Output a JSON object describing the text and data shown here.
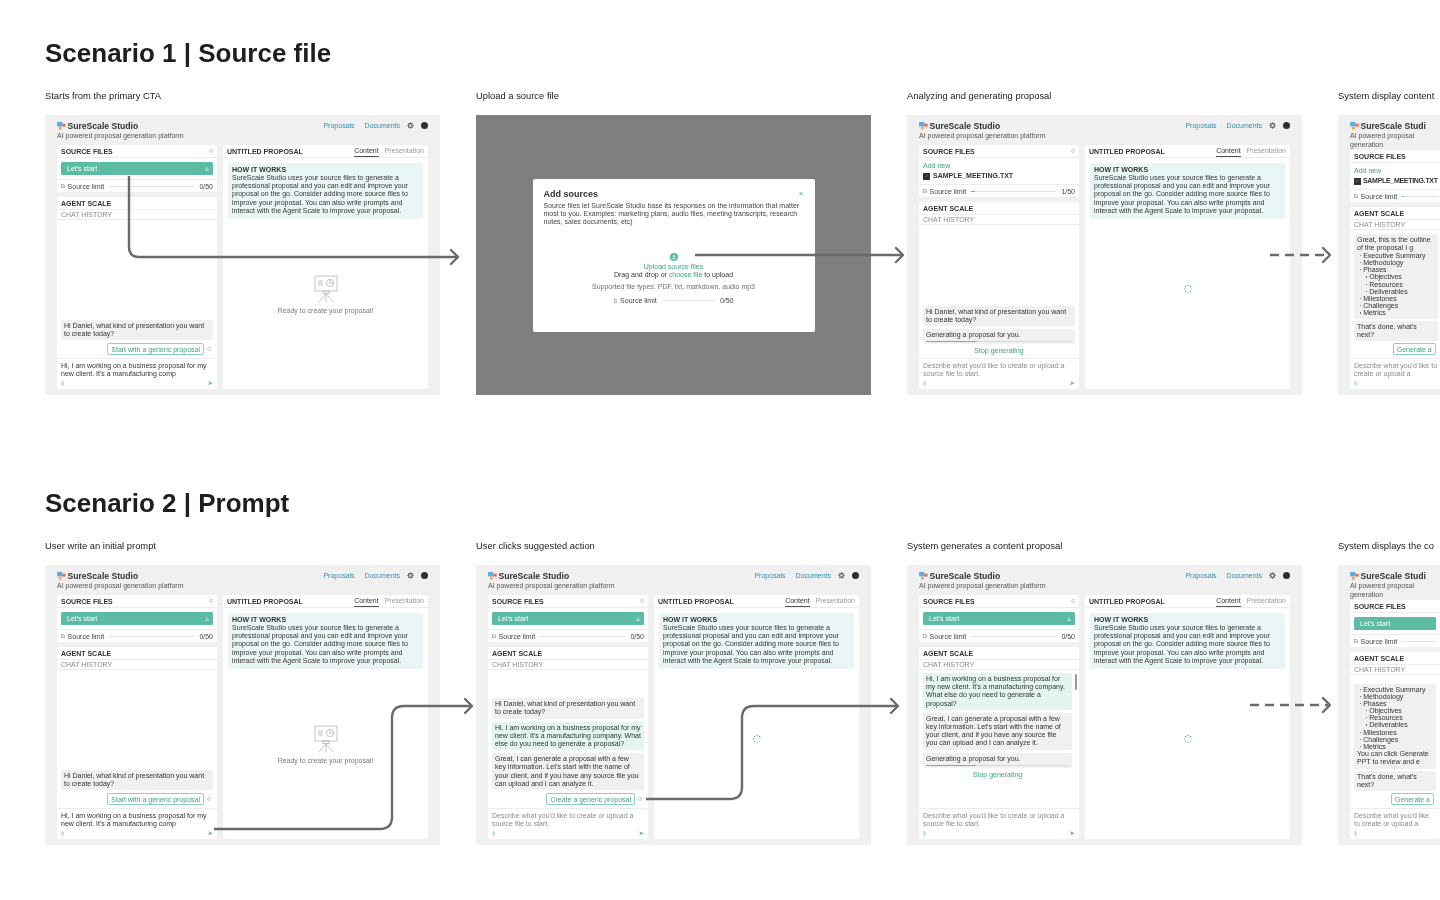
{
  "scenarios": [
    {
      "title": "Scenario 1 | Source file",
      "frames": [
        {
          "caption": "Starts from the primary CTA",
          "kind": "app",
          "app": {
            "title": "SureScale Studio",
            "subtitle": "AI powered proposal generation platform",
            "nav": [
              "Proposals",
              "Documents"
            ],
            "sources": {
              "title": "SOURCE FILES",
              "start_button": "Let's start",
              "limit": {
                "label": "Source limit",
                "level": 0,
                "reading": "0/50"
              }
            },
            "agent": {
              "title": "AGENT SCALE",
              "history": "CHAT HISTORY",
              "messages": [
                {
                  "kind": "agent",
                  "text": "Hi Daniel, what kind of presentation you want to create today?"
                },
                {
                  "kind": "suggestion",
                  "text": "Start with a generic proposal"
                }
              ],
              "composer": {
                "value": "Hi, I am working on a business proposal for my new client. It's a manufacturing comp"
              }
            },
            "proposal": {
              "title": "UNTITLED PROPOSAL",
              "tabs": [
                {
                  "label": "Content",
                  "selected": true
                },
                {
                  "label": "Presentation",
                  "selected": false
                }
              ],
              "info": {
                "title": "HOW IT WORKS",
                "text": "SureScale Studio uses your source files to generate a professional proposal and you can edit and improve your proposal on the go. Consider adding more source files to improve your proposal. You can also write prompts and interact with the Agent Scale to improve your proposal."
              },
              "kind": "empty",
              "empty_text": "Ready to create your proposal!"
            }
          }
        },
        {
          "caption": "Upload a source file",
          "kind": "modal",
          "modal": {
            "title": "Add sources",
            "close": "×",
            "description": "Source files let SureScale Studio base its responses on the information that matter most to you. Examples: marketing plans, audio files, meeting transcripts, research notes, sales documents, etc)",
            "upload_label": "Upload source files",
            "drop": {
              "before": "Drag and drop or ",
              "link": "choose file",
              "after": " to upload"
            },
            "types": "Supported file types: PDF, txt, markdown, audio mp3",
            "limit": {
              "label": "Source limit",
              "level": 0,
              "reading": "0/50"
            }
          }
        },
        {
          "caption": "Analyzing and generating proposal",
          "kind": "app",
          "app": {
            "title": "SureScale Studio",
            "subtitle": "AI powered proposal generation platform",
            "nav": [
              "Proposals",
              "Documents"
            ],
            "sources": {
              "title": "SOURCE FILES",
              "add_new": "Add new",
              "files": [
                {
                  "name": "SAMPLE_MEETING.TXT",
                  "checked": true
                }
              ],
              "limit": {
                "label": "Source limit",
                "level": 0.05,
                "reading": "1/50"
              }
            },
            "agent": {
              "title": "AGENT SCALE",
              "history": "CHAT HISTORY",
              "messages": [
                {
                  "kind": "agent",
                  "text": "Hi Daniel, what kind of presentation you want to create today?"
                },
                {
                  "kind": "progress",
                  "text": "Generating a proposal for you.",
                  "level": 0.35
                },
                {
                  "kind": "stop",
                  "text": "Stop generating"
                }
              ],
              "composer": {
                "placeholder": "Describe what you'd like to create or upload a source file to start."
              }
            },
            "proposal": {
              "title": "UNTITLED PROPOSAL",
              "tabs": [
                {
                  "label": "Content",
                  "selected": true
                },
                {
                  "label": "Presentation",
                  "selected": false
                }
              ],
              "info": {
                "title": "HOW IT WORKS",
                "text": "SureScale Studio uses your source files to generate a professional proposal and you can edit and improve your proposal on the go. Consider adding more source files to improve your proposal. You can also write prompts and interact with the Agent Scale to improve your proposal."
              },
              "kind": "loading"
            }
          }
        },
        {
          "caption": "System display content",
          "kind": "app",
          "cut": true,
          "app": {
            "title": "SureScale Studi",
            "subtitle": "AI powered proposal generation",
            "sources": {
              "title": "SOURCE FILES",
              "add_new": "Add new",
              "files": [
                {
                  "name": "SAMPLE_MEETING.TXT",
                  "checked": true
                }
              ],
              "limit": {
                "label": "Source limit",
                "level": 0.05
              }
            },
            "agent": {
              "title": "AGENT SCALE",
              "history": "CHAT HISTORY",
              "messages": [
                {
                  "kind": "outline",
                  "text": "Great, this is the outline of the proposal I g",
                  "items": [
                    {
                      "text": "Executive Summary"
                    },
                    {
                      "text": "Methodology"
                    },
                    {
                      "text": "Phases",
                      "children": [
                        {
                          "text": "Objectives"
                        },
                        {
                          "text": "Resources"
                        },
                        {
                          "text": "Deliverables"
                        }
                      ]
                    },
                    {
                      "text": "Milestones"
                    },
                    {
                      "text": "Challenges"
                    },
                    {
                      "text": "Metrics"
                    }
                  ]
                },
                {
                  "kind": "agent",
                  "text": "That's done, what's next?"
                },
                {
                  "kind": "suggestion",
                  "text": "Generate a"
                }
              ],
              "composer": {
                "placeholder": "Describe what you'd like to create or upload a"
              }
            }
          }
        }
      ]
    },
    {
      "title": "Scenario 2 | Prompt",
      "frames": [
        {
          "caption": "User write an initial prompt",
          "kind": "app",
          "app": {
            "title": "SureScale Studio",
            "subtitle": "AI powered proposal generation platform",
            "nav": [
              "Proposals",
              "Documents"
            ],
            "sources": {
              "title": "SOURCE FILES",
              "start_button": "Let's start",
              "limit": {
                "label": "Source limit",
                "level": 0,
                "reading": "0/50"
              }
            },
            "agent": {
              "title": "AGENT SCALE",
              "history": "CHAT HISTORY",
              "messages": [
                {
                  "kind": "agent",
                  "text": "Hi Daniel, what kind of presentation you want to create today?"
                },
                {
                  "kind": "suggestion",
                  "text": "Start with a generic proposal"
                }
              ],
              "composer": {
                "value": "Hi, I am working on a business proposal for my new client. It's a manufacturing comp"
              }
            },
            "proposal": {
              "title": "UNTITLED PROPOSAL",
              "tabs": [
                {
                  "label": "Content",
                  "selected": true
                },
                {
                  "label": "Presentation",
                  "selected": false
                }
              ],
              "info": {
                "title": "HOW IT WORKS",
                "text": "SureScale Studio uses your source files to generate a professional proposal and you can edit and improve your proposal on the go. Consider adding more source files to improve your proposal. You can also write prompts and interact with the Agent Scale to improve your proposal."
              },
              "kind": "empty",
              "empty_text": "Ready to create your proposal!"
            }
          }
        },
        {
          "caption": "User clicks suggested action",
          "kind": "app",
          "app": {
            "title": "SureScale Studio",
            "subtitle": "AI powered proposal generation platform",
            "nav": [
              "Proposals",
              "Documents"
            ],
            "sources": {
              "title": "SOURCE FILES",
              "start_button": "Let's start",
              "limit": {
                "label": "Source limit",
                "level": 0,
                "reading": "0/50"
              }
            },
            "agent": {
              "title": "AGENT SCALE",
              "history": "CHAT HISTORY",
              "messages": [
                {
                  "kind": "agent",
                  "text": "Hi Daniel, what kind of presentation you want to create today?"
                },
                {
                  "kind": "user",
                  "text": "Hi, I am working on a business proposal for my new client. It's a manufacturing company. What else do you need to generate a proposal?"
                },
                {
                  "kind": "agent",
                  "text": "Great, I can generate a proposal with a few key information. Let's start with the name of your client, and if you have any source file you can upload and I can analyze it."
                },
                {
                  "kind": "suggestion",
                  "text": "Create a generic proposal"
                }
              ],
              "composer": {
                "placeholder": "Describe what you'd like to create or upload a source file to start."
              }
            },
            "proposal": {
              "title": "UNTITLED PROPOSAL",
              "tabs": [
                {
                  "label": "Content",
                  "selected": true
                },
                {
                  "label": "Presentation",
                  "selected": false
                }
              ],
              "info": {
                "title": "HOW IT WORKS",
                "text": "SureScale Studio uses your source files to generate a professional proposal and you can edit and improve your proposal on the go. Consider adding more source files to improve your proposal. You can also write prompts and interact with the Agent Scale to improve your proposal."
              },
              "kind": "loading"
            }
          }
        },
        {
          "caption": "System generates a content proposal",
          "kind": "app",
          "app": {
            "title": "SureScale Studio",
            "subtitle": "AI powered proposal generation platform",
            "nav": [
              "Proposals",
              "Documents"
            ],
            "sources": {
              "title": "SOURCE FILES",
              "start_button": "Let's start",
              "limit": {
                "label": "Source limit",
                "level": 0,
                "reading": "0/50"
              }
            },
            "agent": {
              "title": "AGENT SCALE",
              "history": "CHAT HISTORY",
              "scrollable": true,
              "messages": [
                {
                  "kind": "user",
                  "text": "Hi, I am working on a business proposal for my new client. It's a manufacturing company. What else do you need to generate a proposal?"
                },
                {
                  "kind": "agent",
                  "text": "Great, I can generate a proposal with a few key information. Let's start with the name of your client, and if you have any source file you can upload and I can analyze it."
                },
                {
                  "kind": "progress",
                  "text": "Generating a proposal for you.",
                  "level": 0.35
                },
                {
                  "kind": "stop",
                  "text": "Stop generating"
                }
              ],
              "composer": {
                "placeholder": "Describe what you'd like to create or upload a source file to start."
              }
            },
            "proposal": {
              "title": "UNTITLED PROPOSAL",
              "tabs": [
                {
                  "label": "Content",
                  "selected": true
                },
                {
                  "label": "Presentation",
                  "selected": false
                }
              ],
              "info": {
                "title": "HOW IT WORKS",
                "text": "SureScale Studio uses your source files to generate a professional proposal and you can edit and improve your proposal on the go. Consider adding more source files to improve your proposal. You can also write prompts and interact with the Agent Scale to improve your proposal."
              },
              "kind": "loading"
            }
          }
        },
        {
          "caption": "System displays the co",
          "kind": "app",
          "cut": true,
          "app": {
            "title": "SureScale Studi",
            "subtitle": "AI powered proposal generation",
            "sources": {
              "title": "SOURCE FILES",
              "start_button": "Let's start",
              "limit": {
                "label": "Source limit",
                "level": 0
              }
            },
            "agent": {
              "title": "AGENT SCALE",
              "history": "CHAT HISTORY",
              "messages": [
                {
                  "kind": "outline",
                  "items": [
                    {
                      "text": "Executive Summary"
                    },
                    {
                      "text": "Methodology"
                    },
                    {
                      "text": "Phases",
                      "children": [
                        {
                          "text": "Objectives"
                        },
                        {
                          "text": "Resources"
                        },
                        {
                          "text": "Deliverables"
                        }
                      ]
                    },
                    {
                      "text": "Milestones"
                    },
                    {
                      "text": "Challenges"
                    },
                    {
                      "text": "Metrics"
                    }
                  ],
                  "footer": "You can click Generate PPT to review and e"
                },
                {
                  "kind": "agent",
                  "text": "That's done, what's next?"
                },
                {
                  "kind": "suggestion",
                  "text": "Generate a"
                }
              ],
              "composer": {
                "placeholder": "Describe what you'd like to create or upload a"
              }
            }
          }
        }
      ]
    }
  ]
}
